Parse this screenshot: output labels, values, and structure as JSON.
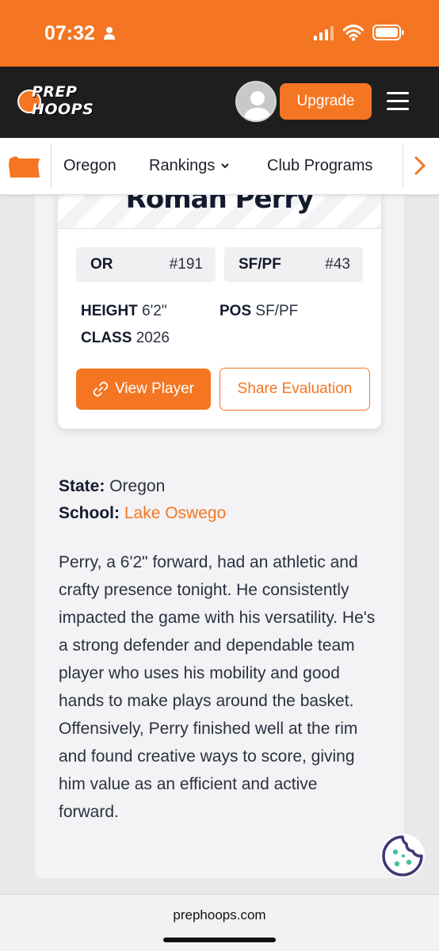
{
  "status_bar": {
    "time": "07:32",
    "accent_color": "#f47622"
  },
  "header": {
    "logo_line1": "PREP",
    "logo_line2": "HOOPS",
    "upgrade_label": "Upgrade",
    "background": "#1e1e1e"
  },
  "nav": {
    "state_icon": "oregon-state-icon",
    "items": [
      "Oregon",
      "Rankings",
      "Club Programs"
    ]
  },
  "player": {
    "name": "Roman Perry",
    "ranks": [
      {
        "label": "OR",
        "value": "#191"
      },
      {
        "label": "SF/PF",
        "value": "#43"
      }
    ],
    "height_label": "HEIGHT",
    "height_value": "6'2\"",
    "pos_label": "POS",
    "pos_value": "SF/PF",
    "class_label": "CLASS",
    "class_value": "2026",
    "view_player_label": "View Player",
    "share_evaluation_label": "Share Evaluation"
  },
  "info": {
    "state_label": "State:",
    "state_value": "Oregon",
    "school_label": "School:",
    "school_value": "Lake Oswego"
  },
  "evaluation": "Perry, a 6'2\" forward, had an athletic and crafty presence tonight. He consistently impacted the game with his versatility. He's a strong defender and dependable team player who uses his mobility and good hands to make plays around the basket. Offensively, Perry finished well at the rim and found creative ways to score, giving him value as an efficient and active forward.",
  "browser": {
    "url": "prephoops.com"
  }
}
